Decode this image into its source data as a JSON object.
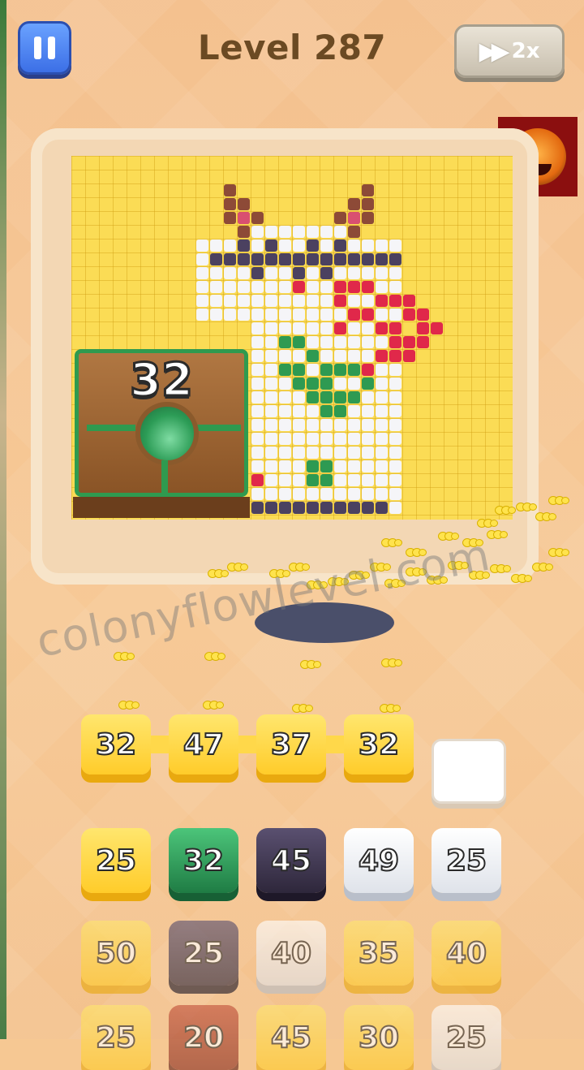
{
  "header": {
    "level_label": "Level 287",
    "speed_label": "2x"
  },
  "colors": {
    "yellow": "#ffd43b",
    "green": "#2e9a52",
    "dark": "#3d3448",
    "white": "#f4f4f6",
    "red": "#e0284a",
    "brown": "#8a4a32"
  },
  "crate": {
    "count": "32"
  },
  "watermark": "colonyflowlevel.com",
  "queue": [
    {
      "value": "32",
      "color": "yellow"
    },
    {
      "value": "47",
      "color": "yellow"
    },
    {
      "value": "37",
      "color": "yellow"
    },
    {
      "value": "32",
      "color": "yellow"
    },
    {
      "value": "",
      "color": "empty"
    }
  ],
  "grid": [
    [
      {
        "value": "25",
        "color": "yellow"
      },
      {
        "value": "32",
        "color": "green"
      },
      {
        "value": "45",
        "color": "dark"
      },
      {
        "value": "49",
        "color": "white"
      },
      {
        "value": "25",
        "color": "white"
      }
    ],
    [
      {
        "value": "50",
        "color": "yellow"
      },
      {
        "value": "25",
        "color": "dark"
      },
      {
        "value": "40",
        "color": "white"
      },
      {
        "value": "35",
        "color": "yellow"
      },
      {
        "value": "40",
        "color": "yellow"
      }
    ],
    [
      {
        "value": "25",
        "color": "yellow"
      },
      {
        "value": "20",
        "color": "brown"
      },
      {
        "value": "45",
        "color": "yellow"
      },
      {
        "value": "30",
        "color": "yellow"
      },
      {
        "value": "25",
        "color": "white"
      }
    ]
  ]
}
